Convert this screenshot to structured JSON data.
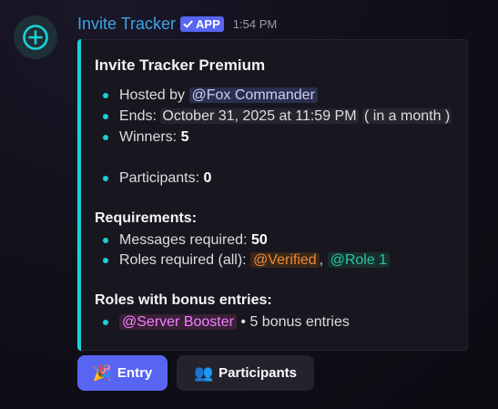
{
  "message": {
    "author": "Invite Tracker",
    "badge": "APP",
    "timestamp": "1:54 PM",
    "avatar_icon": "plus-circle-icon",
    "accent_color": "#19d1d6"
  },
  "embed": {
    "title": "Invite Tracker Premium",
    "hosted_by_label": "Hosted by",
    "host": "@Fox Commander",
    "ends_label": "Ends:",
    "ends_date": "October 31, 2025 at 11:59 PM",
    "ends_relative": "( in a month )",
    "winners_label": "Winners:",
    "winners": "5",
    "participants_label": "Participants:",
    "participants": "0",
    "requirements_title": "Requirements:",
    "messages_label": "Messages required:",
    "messages": "50",
    "roles_label": "Roles required (all):",
    "role_verified": "@Verified",
    "role_separator": ",",
    "role_1": "@Role 1",
    "bonus_title": "Roles with bonus entries:",
    "bonus_role": "@Server Booster",
    "bonus_text": "• 5 bonus entries"
  },
  "buttons": {
    "entry_label": "Entry",
    "entry_emoji": "🎉",
    "participants_label": "Participants",
    "participants_emoji": "👥"
  }
}
